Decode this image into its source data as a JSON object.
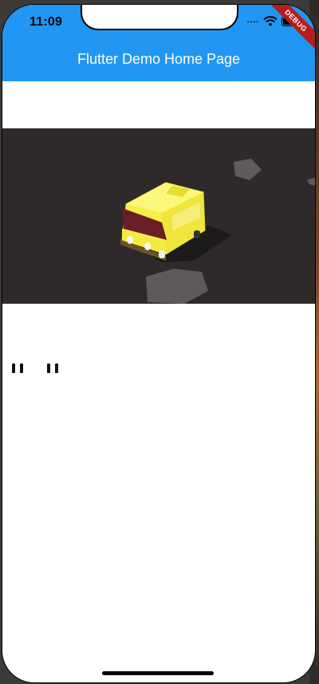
{
  "status_bar": {
    "time": "11:09",
    "debug_label": "DEBUG"
  },
  "app_bar": {
    "title": "Flutter Demo Home Page",
    "color": "#2196f3"
  },
  "controls": [
    {
      "icon": "pause-icon"
    },
    {
      "icon": "pause-icon"
    }
  ]
}
